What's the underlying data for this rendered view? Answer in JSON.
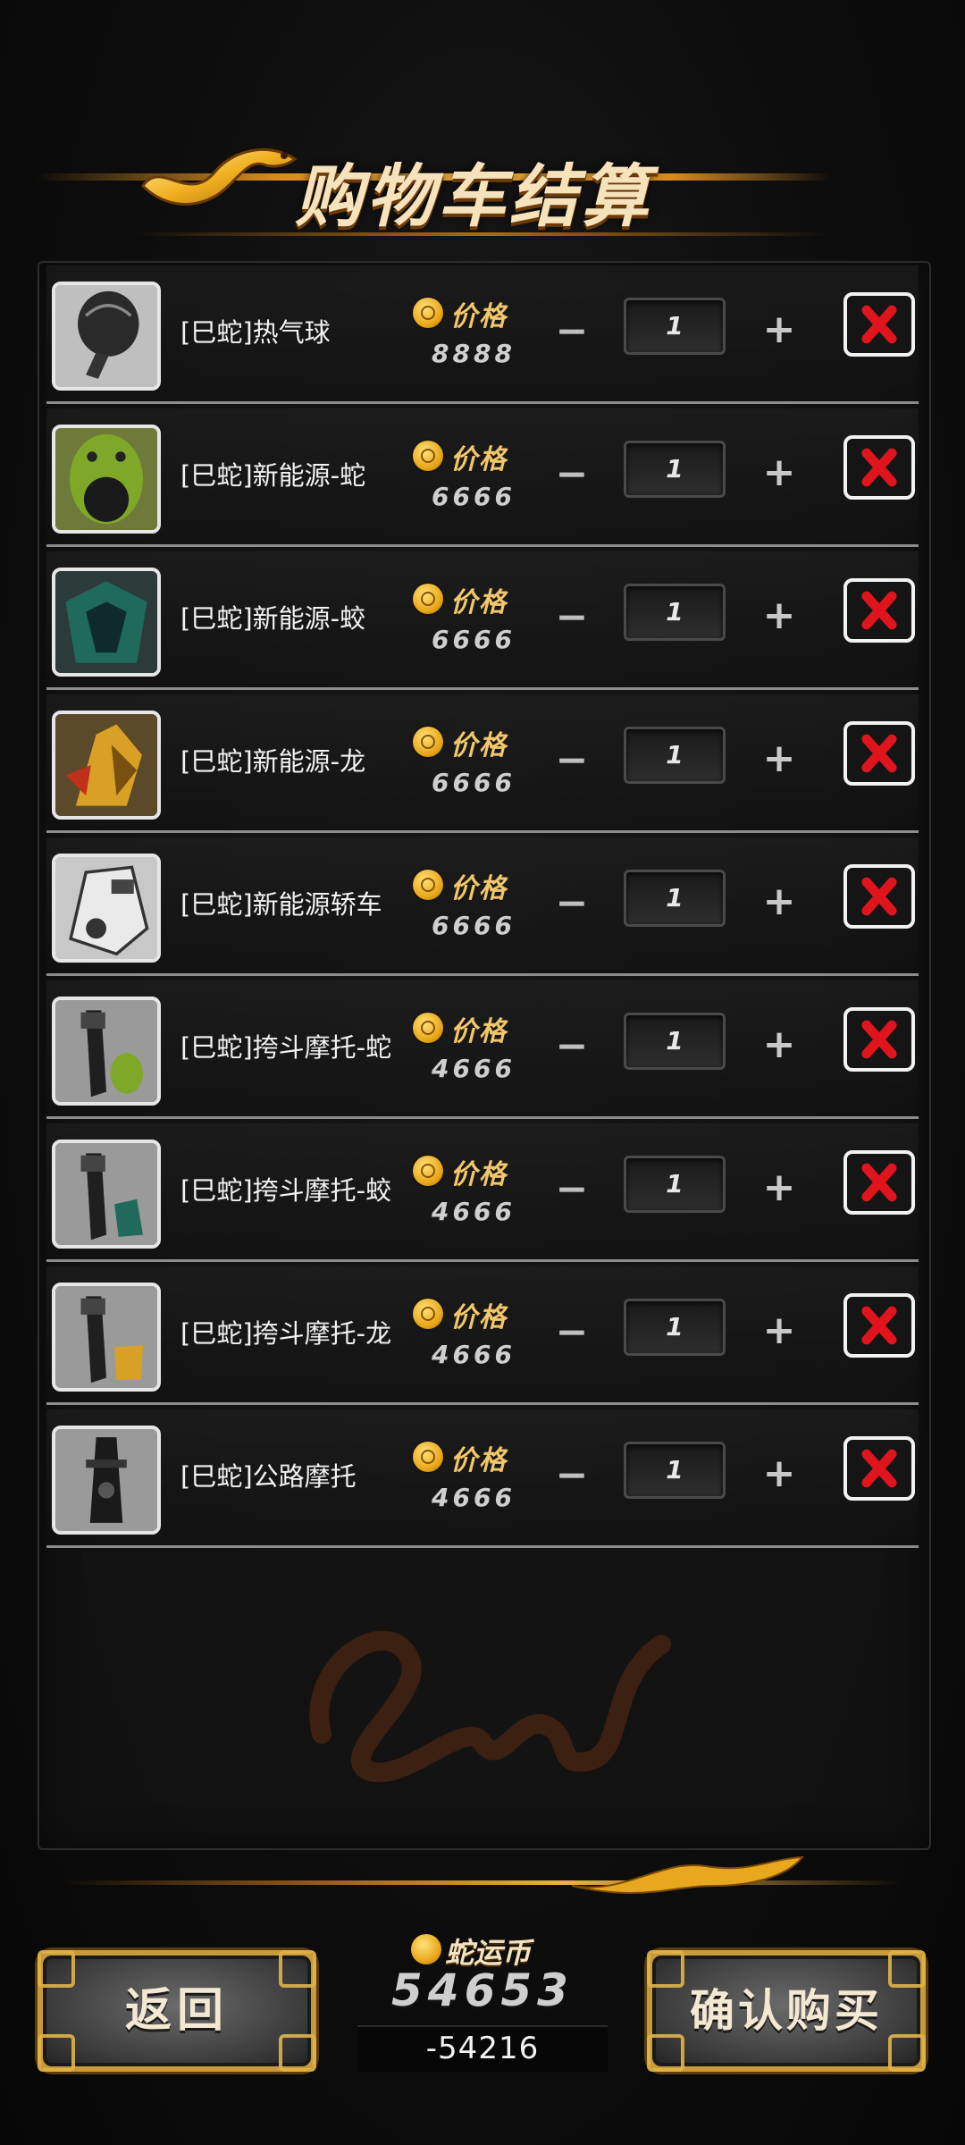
{
  "header": {
    "title": "购物车结算"
  },
  "cart": {
    "price_label": "价格",
    "items": [
      {
        "name": "[巳蛇]热气球",
        "price": "8888",
        "qty": "1",
        "thumb": "hot-air-balloon"
      },
      {
        "name": "[巳蛇]新能源-蛇",
        "price": "6666",
        "qty": "1",
        "thumb": "snake-car"
      },
      {
        "name": "[巳蛇]新能源-蛟",
        "price": "6666",
        "qty": "1",
        "thumb": "jiao-car"
      },
      {
        "name": "[巳蛇]新能源-龙",
        "price": "6666",
        "qty": "1",
        "thumb": "dragon-car"
      },
      {
        "name": "[巳蛇]新能源轿车",
        "price": "6666",
        "qty": "1",
        "thumb": "sedan"
      },
      {
        "name": "[巳蛇]挎斗摩托-蛇",
        "price": "4666",
        "qty": "1",
        "thumb": "sidecar-snake"
      },
      {
        "name": "[巳蛇]挎斗摩托-蛟",
        "price": "4666",
        "qty": "1",
        "thumb": "sidecar-jiao"
      },
      {
        "name": "[巳蛇]挎斗摩托-龙",
        "price": "4666",
        "qty": "1",
        "thumb": "sidecar-dragon"
      },
      {
        "name": "[巳蛇]公路摩托",
        "price": "4666",
        "qty": "1",
        "thumb": "road-motorcycle"
      }
    ],
    "minus_symbol": "−",
    "plus_symbol": "+"
  },
  "footer": {
    "back_label": "返回",
    "confirm_label": "确认购买",
    "currency_label": "蛇运币",
    "balance": "54653",
    "deduction": "-54216"
  },
  "colors": {
    "accent_gold": "#f0b040",
    "remove_red": "#e0141c",
    "background": "#0b0b0b"
  }
}
